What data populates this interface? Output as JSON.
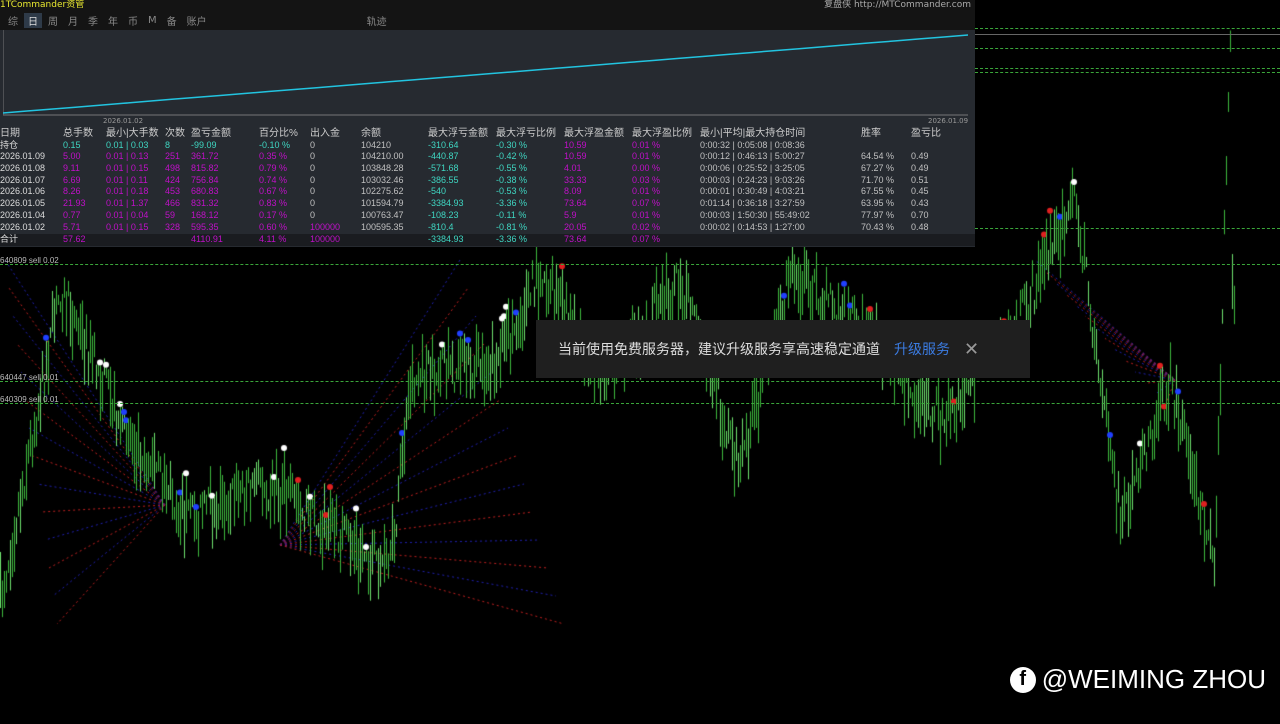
{
  "header": {
    "title": "1TCommander资管",
    "site": "复盘侠 http://MTCommander.com"
  },
  "tabs": [
    "综",
    "日",
    "周",
    "月",
    "季",
    "年",
    "币",
    "M",
    "备",
    "账户",
    "轨迹"
  ],
  "active_tab": "日",
  "mini_chart": {
    "x_start": "2026.01.02",
    "x_end": "2026.01.09",
    "line_color": "#22c4e0"
  },
  "table": {
    "headers": [
      "日期",
      "总手数",
      "最小|大手数",
      "次数",
      "盈亏金额",
      "百分比%",
      "出入金",
      "余额",
      "最大浮亏金额",
      "最大浮亏比例",
      "最大浮盈金额",
      "最大浮盈比例",
      "最小|平均|最大持仓时间",
      "胜率",
      "盈亏比"
    ],
    "rows": [
      [
        "持仓",
        "0.15",
        "0.01 | 0.03",
        "8",
        "-99.09",
        "-0.10 %",
        "0",
        "104210",
        "-310.64",
        "-0.30 %",
        "10.59",
        "0.01 %",
        "0:00:32 | 0:05:08 | 0:08:36",
        "",
        ""
      ],
      [
        "2026.01.09",
        "5.00",
        "0.01 | 0.13",
        "251",
        "361.72",
        "0.35 %",
        "0",
        "104210.00",
        "-440.87",
        "-0.42 %",
        "10.59",
        "0.01 %",
        "0:00:12 | 0:46:13 | 5:00:27",
        "64.54 %",
        "0.49"
      ],
      [
        "2026.01.08",
        "9.11",
        "0.01 | 0.15",
        "498",
        "815.82",
        "0.79 %",
        "0",
        "103848.28",
        "-571.68",
        "-0.55 %",
        "4.01",
        "0.00 %",
        "0:00:06 | 0:25:52 | 3:25:05",
        "67.27 %",
        "0.49"
      ],
      [
        "2026.01.07",
        "6.69",
        "0.01 | 0.11",
        "424",
        "756.84",
        "0.74 %",
        "0",
        "103032.46",
        "-386.55",
        "-0.38 %",
        "33.33",
        "0.03 %",
        "0:00:03 | 0:24:23 | 9:03:26",
        "71.70 %",
        "0.51"
      ],
      [
        "2026.01.06",
        "8.26",
        "0.01 | 0.18",
        "453",
        "680.83",
        "0.67 %",
        "0",
        "102275.62",
        "-540",
        "-0.53 %",
        "8.09",
        "0.01 %",
        "0:00:01 | 0:30:49 | 4:03:21",
        "67.55 %",
        "0.45"
      ],
      [
        "2026.01.05",
        "21.93",
        "0.01 | 1.37",
        "466",
        "831.32",
        "0.83 %",
        "0",
        "101594.79",
        "-3384.93",
        "-3.36 %",
        "73.64",
        "0.07 %",
        "0:01:14 | 0:36:18 | 3:27:59",
        "63.95 %",
        "0.43"
      ],
      [
        "2026.01.04",
        "0.77",
        "0.01 | 0.04",
        "59",
        "168.12",
        "0.17 %",
        "0",
        "100763.47",
        "-108.23",
        "-0.11 %",
        "5.9",
        "0.01 %",
        "0:00:03 | 1:50:30 | 55:49:02",
        "77.97 %",
        "0.70"
      ],
      [
        "2026.01.02",
        "5.71",
        "0.01 | 0.15",
        "328",
        "595.35",
        "0.60 %",
        "100000",
        "100595.35",
        "-810.4",
        "-0.81 %",
        "20.05",
        "0.02 %",
        "0:00:02 | 0:14:53 | 1:27:00",
        "70.43 %",
        "0.48"
      ]
    ],
    "total": [
      "合计",
      "57.62",
      "",
      "",
      "4110.91",
      "4.11 %",
      "100000",
      "",
      "-3384.93",
      "-3.36 %",
      "73.64",
      "0.07 %",
      "",
      "",
      ""
    ]
  },
  "orders": [
    "640809 sell 0.02",
    "640447 sell 0.01",
    "640309 sell 0.01"
  ],
  "toast": {
    "message": "当前使用免费服务器，建议升级服务享高速稳定通道",
    "link": "升级服务",
    "close": "✕"
  },
  "watermark": {
    "icon": "f",
    "text": "@WEIMING ZHOU"
  },
  "colors": {
    "bull": "#3cb83c",
    "cyan": "#3fd6c2",
    "magenta": "#c010c8",
    "grid": "#3aa63a"
  }
}
